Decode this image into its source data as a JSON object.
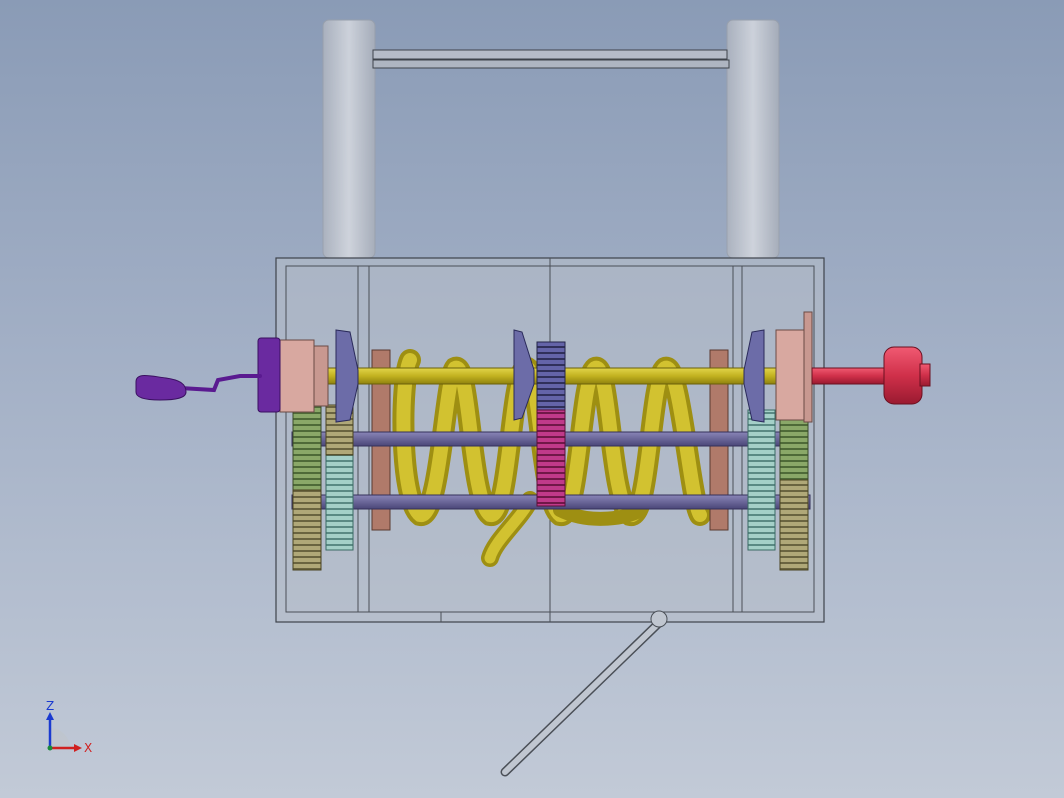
{
  "viewport": {
    "background_top": "#8a9bb6",
    "background_bottom": "#c2cad7",
    "content": "cad-assembly-front-view"
  },
  "colors": {
    "frame_glass": "#b9c0cc",
    "frame_edge": "#4a4f57",
    "support_post": "#c5c8cf",
    "spring": "#cdbd27",
    "spring_shadow": "#9e8f12",
    "upper_shaft": "#c8b820",
    "lower_shaft": "#6e6a9a",
    "handle": "#6a2aa0",
    "red_knob": "#d0304a",
    "gear_green": "#8aa868",
    "gear_olive": "#a8a070",
    "gear_teal": "#9cc8c0",
    "gear_magenta": "#b02a7a",
    "gear_blue": "#5a5a9a",
    "disc_brown": "#b07a6a",
    "cone_blue": "#6c6ca8",
    "flange_pink": "#d8a8a0"
  },
  "triad": {
    "z_label": "Z",
    "x_label": "X",
    "z_color": "#1a3ad0",
    "x_color": "#d02020"
  }
}
